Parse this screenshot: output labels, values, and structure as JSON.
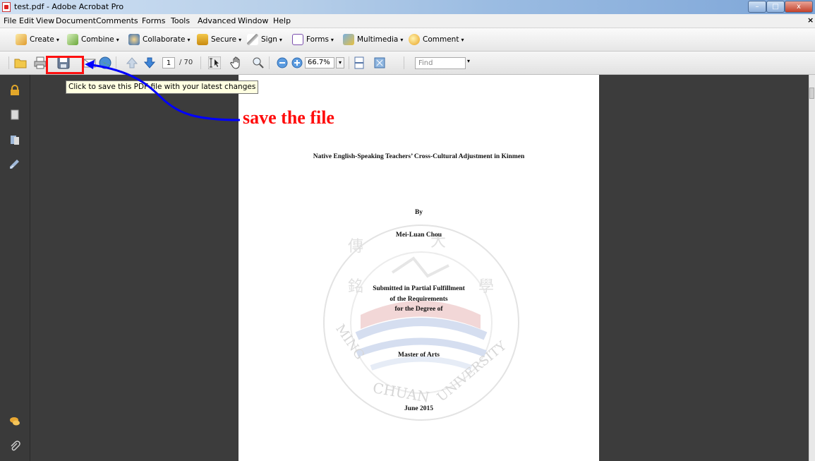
{
  "window": {
    "title": "test.pdf - Adobe Acrobat Pro",
    "controls": {
      "minimize": "–",
      "maximize": "□",
      "close": "x"
    }
  },
  "menubar": {
    "items": [
      "File",
      "Edit",
      "View",
      "Document",
      "Comments",
      "Forms",
      "Tools",
      "Advanced",
      "Window",
      "Help"
    ],
    "close_doc": "×"
  },
  "tasks": {
    "items": [
      {
        "label": "Create",
        "icon": "create-icon"
      },
      {
        "label": "Combine",
        "icon": "combine-icon"
      },
      {
        "label": "Collaborate",
        "icon": "collaborate-icon"
      },
      {
        "label": "Secure",
        "icon": "lock-icon"
      },
      {
        "label": "Sign",
        "icon": "pen-icon"
      },
      {
        "label": "Forms",
        "icon": "forms-icon"
      },
      {
        "label": "Multimedia",
        "icon": "multimedia-icon"
      },
      {
        "label": "Comment",
        "icon": "comment-icon"
      }
    ],
    "caret": "▾"
  },
  "toolbar": {
    "page_current": "1",
    "page_total": "/ 70",
    "zoom": "66.7%",
    "find_placeholder": "Find",
    "caret": "▾"
  },
  "tooltip": {
    "text": "Click to save this PDF file with your latest changes"
  },
  "annotation": {
    "label": "save the file",
    "color": "#ff0d0d",
    "arrow_color": "#0000ff"
  },
  "document": {
    "title": "Native English-Speaking Teachers’ Cross-Cultural Adjustment in Kinmen",
    "by": "By",
    "author": "Mei-Luan Chou",
    "submitted_lines": [
      "Submitted in Partial Fulfillment",
      "of the Requirements",
      "for the Degree of"
    ],
    "degree": "Master of Arts",
    "date": "June 2015",
    "seal_text_left": "MING",
    "seal_text_bottom": "CHUAN",
    "seal_text_right": "UNIVERSITY",
    "seal_chars": [
      "傳",
      "大",
      "學",
      "銘"
    ]
  },
  "colors": {
    "accent_blue": "#0000ff",
    "highlight_red": "#ff1010",
    "doc_background": "#3c3c3c"
  }
}
